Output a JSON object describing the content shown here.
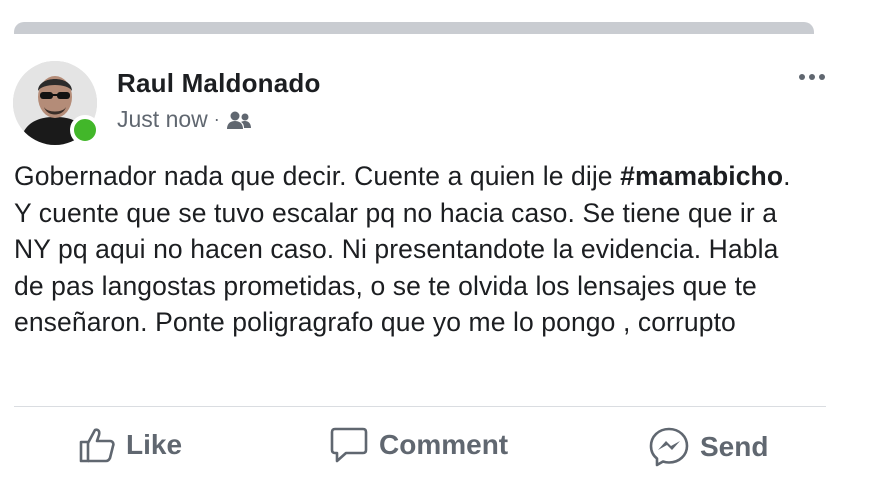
{
  "post": {
    "author": "Raul Maldonado",
    "timestamp": "Just now",
    "separator": "·",
    "audience_icon": "friends-icon",
    "text_before_hashtag": "Gobernador nada que decir. Cuente a quien le dije ",
    "hashtag": "#mamabicho",
    "text_after_hashtag": ". Y cuente que se tuvo escalar pq no hacia caso. Se tiene que ir a NY pq aqui no hacen caso. Ni presentandote la evidencia. Habla de pas langostas prometidas, o se te olvida los lensajes que te enseñaron. Ponte poligragrafo que yo me lo pongo , corrupto"
  },
  "actions": {
    "like_label": "Like",
    "comment_label": "Comment",
    "send_label": "Send"
  },
  "colors": {
    "online": "#42b72a",
    "text": "#1c1e21",
    "muted": "#606770"
  }
}
